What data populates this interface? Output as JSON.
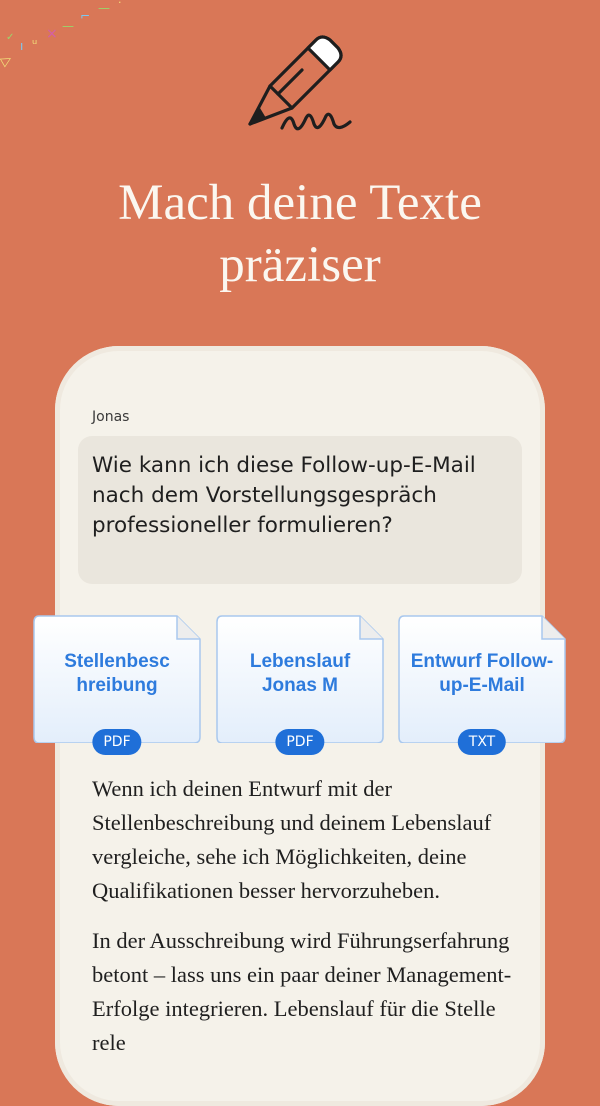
{
  "hero": {
    "headline_line1": "Mach deine Texte",
    "headline_line2": "präziser",
    "icon": "pencil-signature-icon"
  },
  "chat": {
    "sender": "Jonas",
    "message": "Wie kann ich diese Follow-up-E-Mail nach dem Vorstellungsgespräch professioneller formulieren?"
  },
  "attachments": [
    {
      "name": "Stellenbesc hreibung",
      "type": "PDF"
    },
    {
      "name": "Lebenslauf Jonas M",
      "type": "PDF"
    },
    {
      "name": "Entwurf Follow-up-E-Mail",
      "type": "TXT"
    }
  ],
  "response": {
    "paragraph1": "Wenn ich deinen Entwurf mit der Stellenbeschreibung und deinem Lebenslauf vergleiche, sehe ich Möglichkeiten, deine Qualifikationen besser hervorzuheben.",
    "paragraph2": "In der Ausschreibung wird Führungserfahrung betont – lass uns ein paar deiner Management-Erfolge integrieren. Lebenslauf für die Stelle rele"
  },
  "colors": {
    "background": "#D97757",
    "card": "#F5F2EA",
    "bubble": "#EAE6DD",
    "file_text": "#2E7BDD",
    "badge": "#1F6FD8"
  }
}
